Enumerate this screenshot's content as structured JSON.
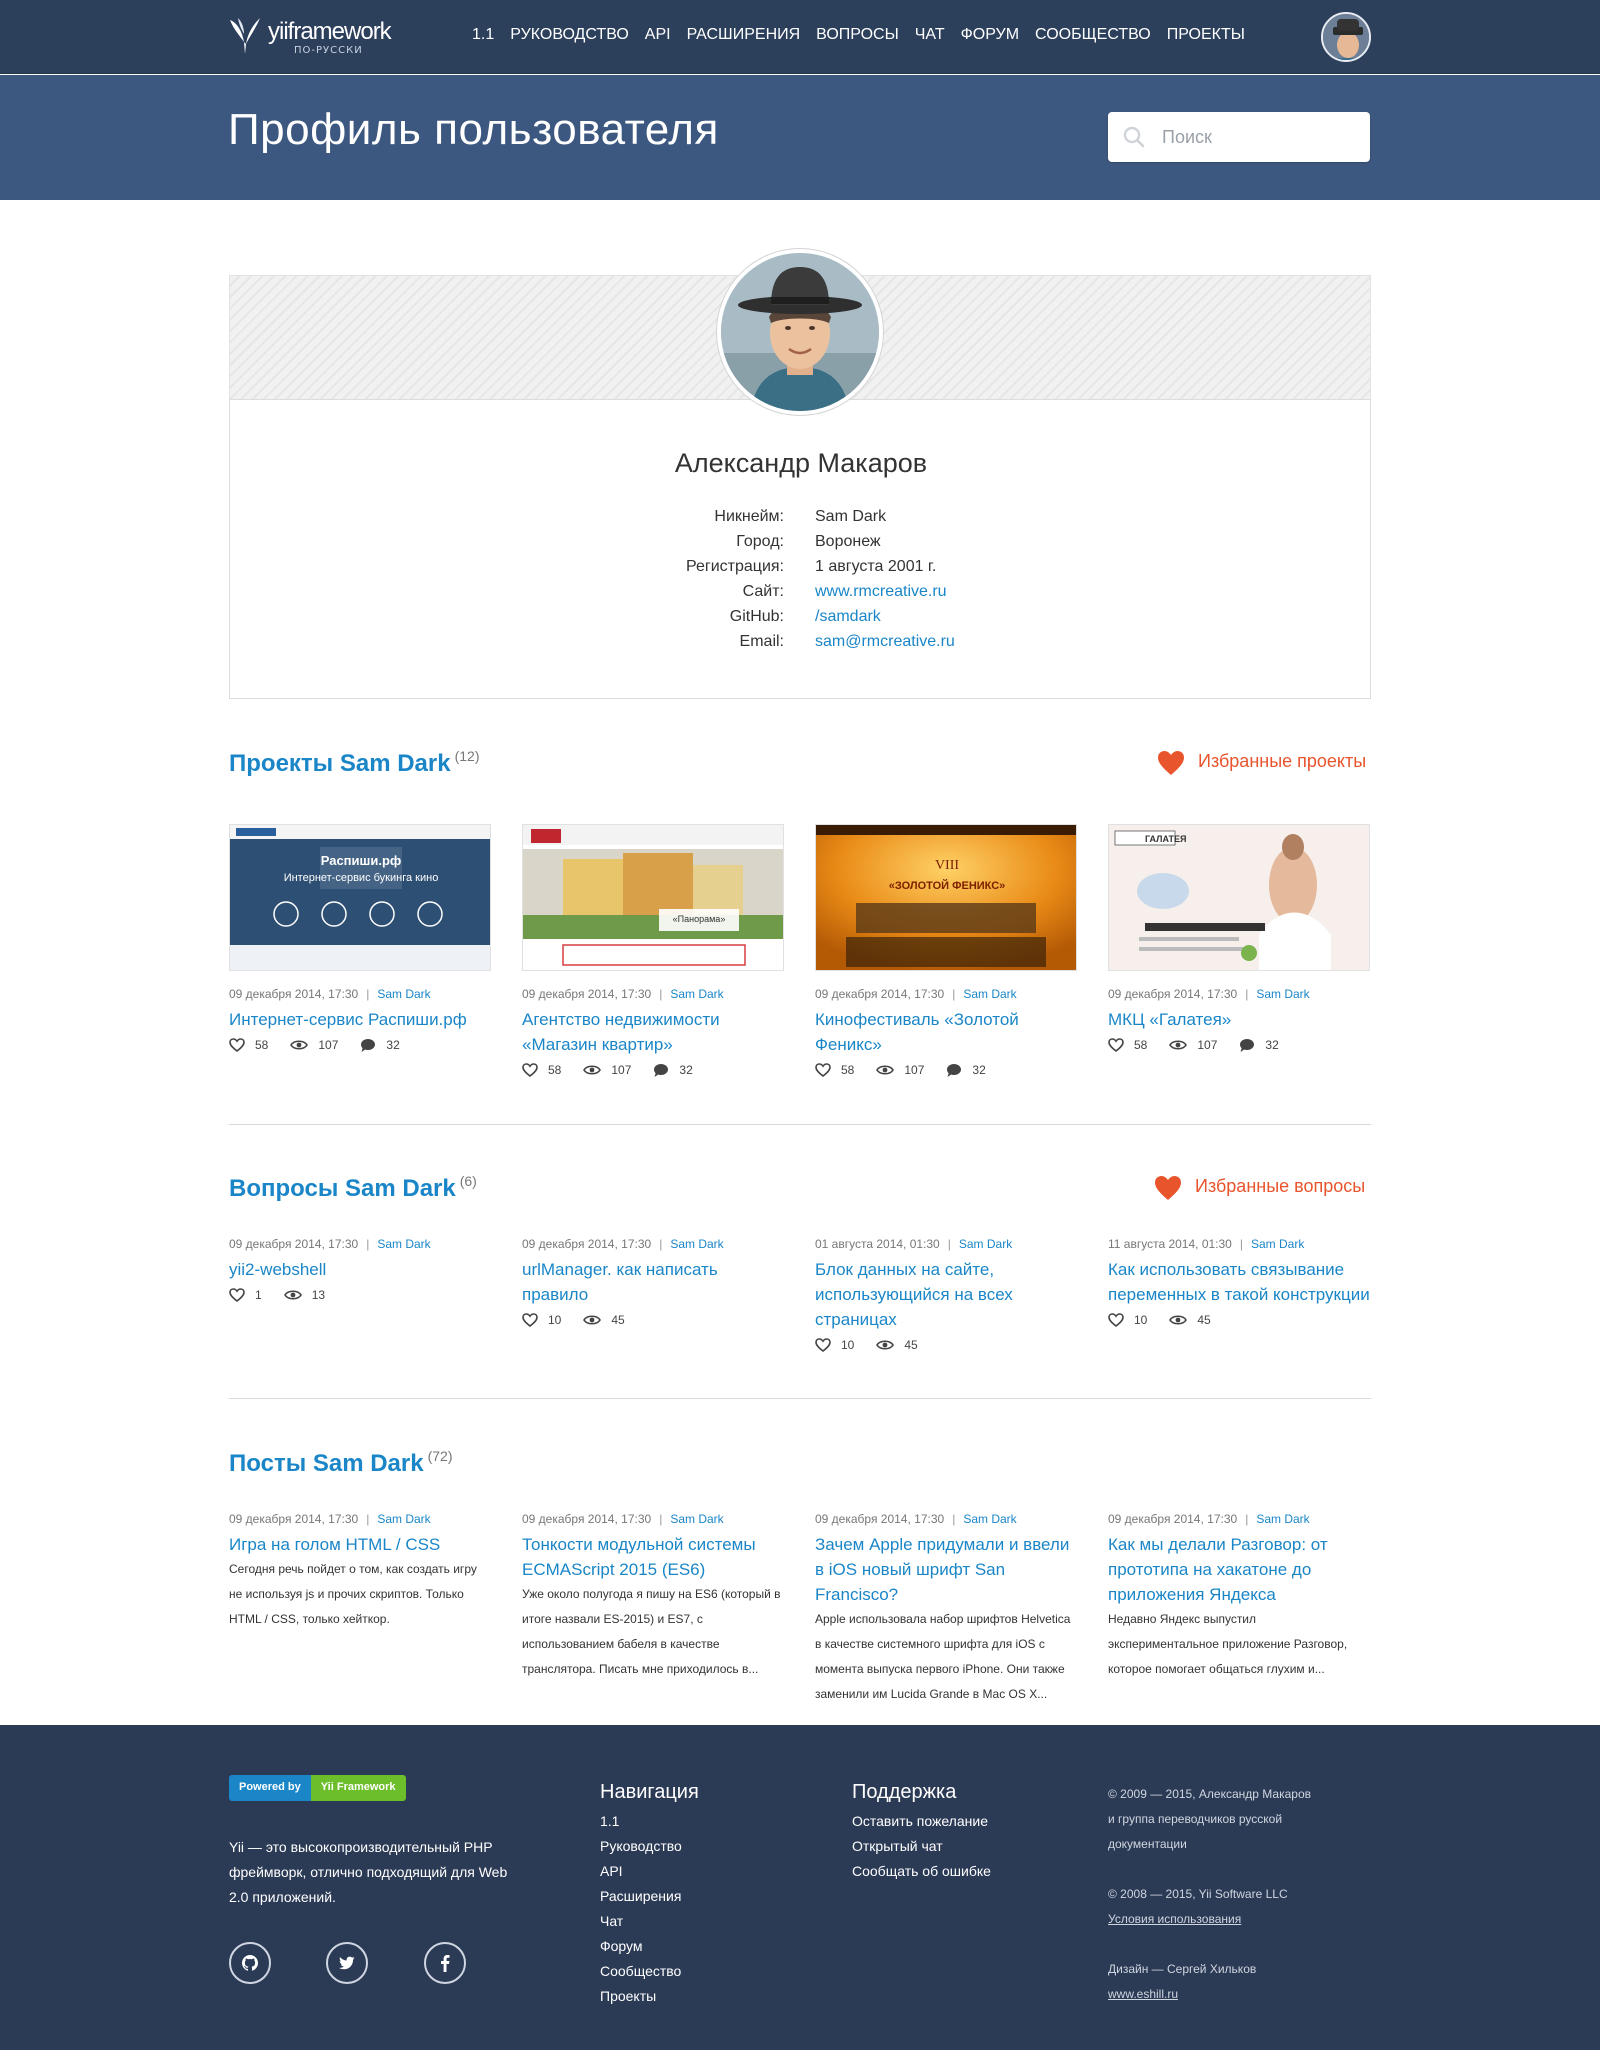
{
  "header": {
    "logo_text": "yiiframework",
    "logo_sub": "ПО-РУССКИ",
    "nav": [
      "1.1",
      "РУКОВОДСТВО",
      "API",
      "РАСШИРЕНИЯ",
      "ВОПРОСЫ",
      "ЧАТ",
      "ФОРУМ",
      "СООБЩЕСТВО",
      "ПРОЕКТЫ"
    ]
  },
  "hero": {
    "title": "Профиль пользователя",
    "search_placeholder": "Поиск"
  },
  "profile": {
    "name": "Александр Макаров",
    "fields": [
      {
        "label": "Никнейм:",
        "value": "Sam Dark"
      },
      {
        "label": "Город:",
        "value": "Воронеж"
      },
      {
        "label": "Регистрация:",
        "value": "1 августа 2001 г."
      },
      {
        "label": "Сайт:",
        "value": "www.rmcreative.ru"
      },
      {
        "label": "GitHub:",
        "value": "/samdark"
      },
      {
        "label": "Email:",
        "value": "sam@rmcreative.ru"
      }
    ]
  },
  "projects": {
    "title": "Проекты Sam Dark",
    "count": "(12)",
    "fav": "Избранные проекты",
    "items": [
      {
        "date": "09 декабря 2014, 17:30",
        "author": "Sam Dark",
        "title": "Интернет-сервис Распиши.рф",
        "likes": "58",
        "views": "107",
        "comments": "32",
        "thumb_title": "Распиши.рф",
        "thumb_sub": "Интернет-сервис букинга кино"
      },
      {
        "date": "09 декабря 2014, 17:30",
        "author": "Sam Dark",
        "title": "Агентство недвижимости «Магазин квартир»",
        "likes": "58",
        "views": "107",
        "comments": "32",
        "thumb_title": "«Панорама»"
      },
      {
        "date": "09 декабря 2014, 17:30",
        "author": "Sam Dark",
        "title": "Кинофестиваль «Золотой Феникс»",
        "likes": "58",
        "views": "107",
        "comments": "32",
        "thumb_title": "«ЗОЛОТОЙ ФЕНИКС»",
        "thumb_sub": "VIII"
      },
      {
        "date": "09 декабря 2014, 17:30",
        "author": "Sam Dark",
        "title": "МКЦ «Галатея»",
        "likes": "58",
        "views": "107",
        "comments": "32",
        "thumb_title": "ГАЛАТЕЯ"
      }
    ]
  },
  "questions": {
    "title": "Вопросы Sam Dark",
    "count": "(6)",
    "fav": "Избранные вопросы",
    "items": [
      {
        "date": "09 декабря 2014, 17:30",
        "author": "Sam Dark",
        "title": "yii2-webshell",
        "likes": "1",
        "views": "13"
      },
      {
        "date": "09 декабря 2014, 17:30",
        "author": "Sam Dark",
        "title": "urlManager. как написать правило",
        "likes": "10",
        "views": "45"
      },
      {
        "date": "01 августа 2014, 01:30",
        "author": "Sam Dark",
        "title": "Блок данных на сайте, использующийся на всех страницах",
        "likes": "10",
        "views": "45"
      },
      {
        "date": "11 августа 2014, 01:30",
        "author": "Sam Dark",
        "title": "Как использовать связывание переменных в такой конструкции",
        "likes": "10",
        "views": "45"
      }
    ]
  },
  "posts": {
    "title": "Посты Sam Dark",
    "count": "(72)",
    "items": [
      {
        "date": "09 декабря 2014, 17:30",
        "author": "Sam Dark",
        "title": "Игра на голом HTML / CSS",
        "excerpt": "Сегодня речь пойдет о том, как создать игру не используя js и прочих скриптов. Только HTML / CSS, только хейткор."
      },
      {
        "date": "09 декабря 2014, 17:30",
        "author": "Sam Dark",
        "title": "Тонкости модульной системы ECMAScript 2015 (ES6)",
        "excerpt": "Уже около полугода я пишу на ES6 (который в итоге назвали ES-2015) и ES7, с использованием бабеля в качестве транслятора. Писать мне приходилось в..."
      },
      {
        "date": "09 декабря 2014, 17:30",
        "author": "Sam Dark",
        "title": "Зачем Apple придумали и ввели в iOS новый шрифт San Francisco?",
        "excerpt": "Apple использовала набор шрифтов Helvetica в качестве системного шрифта для iOS с момента выпуска первого iPhone. Они также заменили им Lucida Grande в Mac OS X..."
      },
      {
        "date": "09 декабря 2014, 17:30",
        "author": "Sam Dark",
        "title": "Как мы делали Разговор: от прототипа на хакатоне до приложения Яндекса",
        "excerpt": "Недавно Яндекс выпустил экспериментальное приложение Разговор, которое помогает общаться глухим и..."
      }
    ]
  },
  "footer": {
    "powered_by": "Powered by",
    "powered_name": "Yii Framework",
    "about": "Yii — это высокопроизводительный PHP фреймворк, отлично подходящий для Web 2.0 приложений.",
    "nav_title": "Навигация",
    "nav_links": [
      "1.1",
      "Руководство",
      "API",
      "Расширения",
      "Чат",
      "Форум",
      "Сообщество",
      "Проекты"
    ],
    "support_title": "Поддержка",
    "support_links": [
      "Оставить пожелание",
      "Открытый чат",
      "Сообщать об ошибке"
    ],
    "copy1": "© 2009 — 2015, Александр Макаров",
    "copy1b": "и группа переводчиков русской",
    "copy1c": "документации",
    "copy2": "© 2008 — 2015, Yii Software LLC",
    "terms": "Условия использования",
    "design": "Дизайн — Сергей Хильков",
    "design_link": "www.eshill.ru"
  },
  "colors": {
    "topbar": "#2c3f5b",
    "hero": "#3d5880",
    "link": "#1a86c8",
    "accent": "#e8542c",
    "footer": "#2b3a55"
  }
}
